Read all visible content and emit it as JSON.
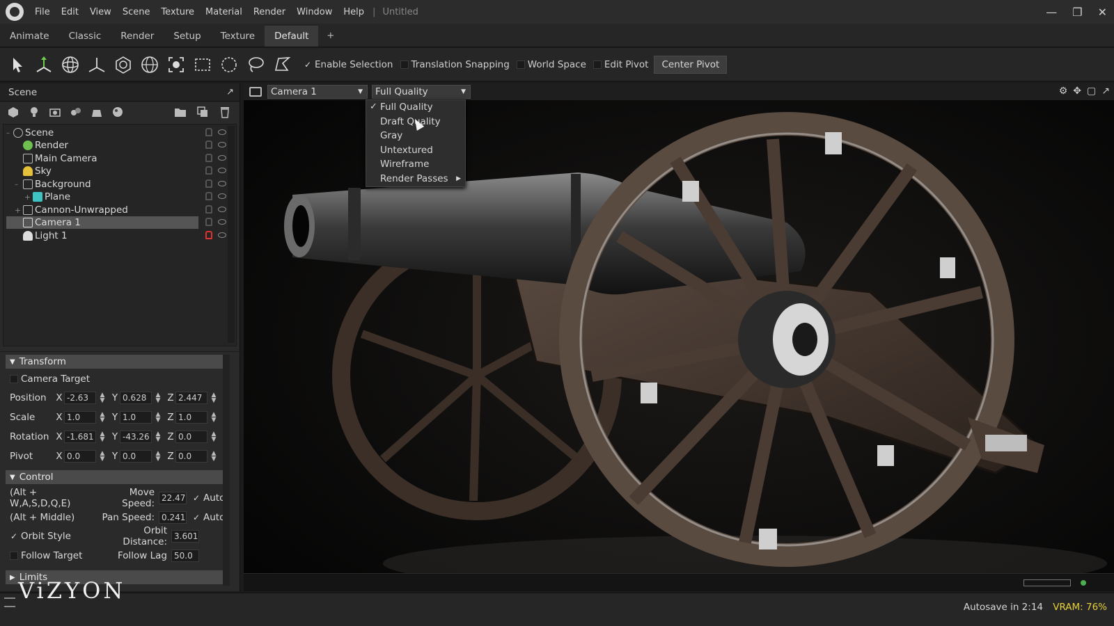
{
  "menubar": {
    "items": [
      "File",
      "Edit",
      "View",
      "Scene",
      "Texture",
      "Material",
      "Render",
      "Window",
      "Help"
    ],
    "separator": "|",
    "document_title": "Untitled"
  },
  "layout_tabs": {
    "items": [
      "Animate",
      "Classic",
      "Render",
      "Setup",
      "Texture",
      "Default"
    ],
    "active": "Default",
    "add": "+"
  },
  "toolbar": {
    "tools": [
      "select-arrow-icon",
      "move-gizmo-icon",
      "rotate-gizmo-icon",
      "axis-icon",
      "scale-gizmo-icon",
      "sphere-gizmo-icon",
      "focus-frame-icon",
      "rect-select-icon",
      "circle-select-icon",
      "lasso-select-icon",
      "poly-select-icon"
    ],
    "enable_selection": "Enable Selection",
    "translation_snapping": "Translation Snapping",
    "world_space": "World Space",
    "edit_pivot": "Edit Pivot",
    "center_pivot": "Center Pivot",
    "enable_selection_checked": true,
    "translation_snapping_checked": false,
    "world_space_checked": false,
    "edit_pivot_checked": false
  },
  "scene_panel": {
    "title": "Scene",
    "tree": [
      {
        "label": "Scene",
        "icon": "scene-icon",
        "locked": false
      },
      {
        "label": "Render",
        "icon": "render-gear-icon",
        "locked": false
      },
      {
        "label": "Main Camera",
        "icon": "camera-icon",
        "locked": false
      },
      {
        "label": "Sky",
        "icon": "sky-icon",
        "locked": false
      },
      {
        "label": "Background",
        "icon": "background-icon",
        "locked": false
      },
      {
        "label": "Plane",
        "icon": "plane-mesh-icon",
        "locked": false
      },
      {
        "label": "Cannon-Unwrapped",
        "icon": "group-icon",
        "locked": false
      },
      {
        "label": "Camera 1",
        "icon": "camera-icon",
        "locked": false,
        "selected": true
      },
      {
        "label": "Light 1",
        "icon": "light-icon",
        "locked": true
      }
    ]
  },
  "transform": {
    "title": "Transform",
    "camera_target": "Camera Target",
    "axes": [
      "X",
      "Y",
      "Z"
    ],
    "rows": [
      {
        "label": "Position",
        "x": "-2.63",
        "y": "0.628",
        "z": "2.447"
      },
      {
        "label": "Scale",
        "x": "1.0",
        "y": "1.0",
        "z": "1.0"
      },
      {
        "label": "Rotation",
        "x": "-1.681",
        "y": "-43.26",
        "z": "0.0"
      },
      {
        "label": "Pivot",
        "x": "0.0",
        "y": "0.0",
        "z": "0.0"
      }
    ]
  },
  "control": {
    "title": "Control",
    "move_hint": "(Alt + W,A,S,D,Q,E)",
    "move_label": "Move Speed:",
    "move_value": "22.47",
    "pan_hint": "(Alt + Middle)",
    "pan_label": "Pan Speed:",
    "pan_value": "0.241",
    "auto": "Auto",
    "orbit_style": "Orbit Style",
    "orbit_distance_label": "Orbit Distance:",
    "orbit_distance_value": "3.601",
    "follow_target": "Follow Target",
    "follow_lag_label": "Follow Lag",
    "follow_lag_value": "50.0"
  },
  "limits": {
    "title": "Limits"
  },
  "viewport": {
    "camera": "Camera 1",
    "quality": "Full Quality",
    "quality_options": [
      "Full Quality",
      "Draft Quality",
      "Gray",
      "Untextured",
      "Wireframe",
      "Render Passes"
    ],
    "selected_option": "Full Quality"
  },
  "status": {
    "autosave": "Autosave in 2:14",
    "vram": "VRAM: 76%",
    "vram_color": "#e6d23a"
  },
  "watermark": "ViZYON"
}
